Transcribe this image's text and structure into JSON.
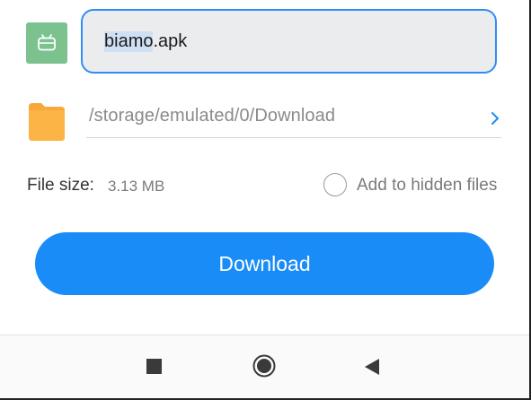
{
  "file": {
    "name_selected": "biamo",
    "name_rest": ".apk"
  },
  "path": {
    "value": "/storage/emulated/0/Download"
  },
  "info": {
    "size_label": "File size:",
    "size_value": "3.13 MB",
    "hidden_label": "Add to hidden files",
    "hidden_checked": false
  },
  "actions": {
    "download_label": "Download"
  },
  "icons": {
    "file_type": "android-apk-icon",
    "folder": "folder-icon",
    "path_chevron": "chevron-right-icon",
    "nav_recents": "square-icon",
    "nav_home": "circle-icon",
    "nav_back": "back-triangle-icon"
  },
  "colors": {
    "accent": "#1a8cf7",
    "apk_green": "#7cc28f",
    "folder_orange": "#f7a83a"
  }
}
